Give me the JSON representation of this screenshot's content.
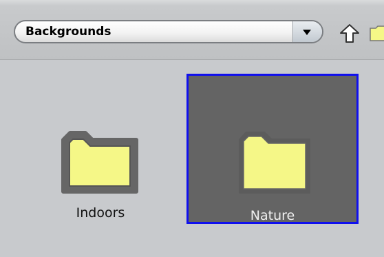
{
  "toolbar": {
    "location_value": "Backgrounds",
    "dropdown_icon": "chevron-down-icon",
    "up_icon": "up-arrow-icon",
    "new_folder_icon": "folder-icon"
  },
  "items": [
    {
      "label": "Indoors",
      "icon": "folder-icon",
      "selected": false
    },
    {
      "label": "Nature",
      "icon": "folder-icon",
      "selected": true
    }
  ],
  "colors": {
    "folder_fill": "#f5f787",
    "folder_outline": "#666666",
    "selection_border": "#1010ee",
    "selection_background": "#646464"
  }
}
